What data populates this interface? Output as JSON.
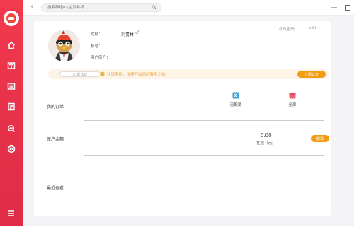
{
  "search": {
    "placeholder": "搜索群组ID/主页名称"
  },
  "sidebar": {
    "items": [
      {
        "icon": "home-icon"
      },
      {
        "icon": "book-icon"
      },
      {
        "icon": "list-icon"
      },
      {
        "icon": "document-icon"
      },
      {
        "icon": "analytics-icon"
      },
      {
        "icon": "settings-icon"
      },
      {
        "icon": "menu-icon"
      }
    ]
  },
  "profile": {
    "nickname_label": "昵称：",
    "nickname": "刘青林",
    "gender_symbol": "♂",
    "account_label": "帐号：",
    "intro_label": "用户简介：",
    "change_password": "修改密码",
    "edit": "edit"
  },
  "verify": {
    "status": "◇ 未认证",
    "message": "认证身份，快速开启您的教学之旅",
    "button": "立即认证"
  },
  "orders": {
    "label": "我的订单",
    "items": [
      {
        "label": "已取消",
        "icon": "cancelled-order-icon",
        "color": "#3aa0d8"
      },
      {
        "label": "全部",
        "icon": "all-orders-icon",
        "color": "#f06272"
      }
    ]
  },
  "balance": {
    "label": "账户余额",
    "amount": "0.00",
    "note": "在途（元）",
    "withdraw": "提现"
  },
  "recent": {
    "label": "最近查看"
  },
  "colors": {
    "accent": "#f13a4d",
    "orange": "#f29c16"
  }
}
